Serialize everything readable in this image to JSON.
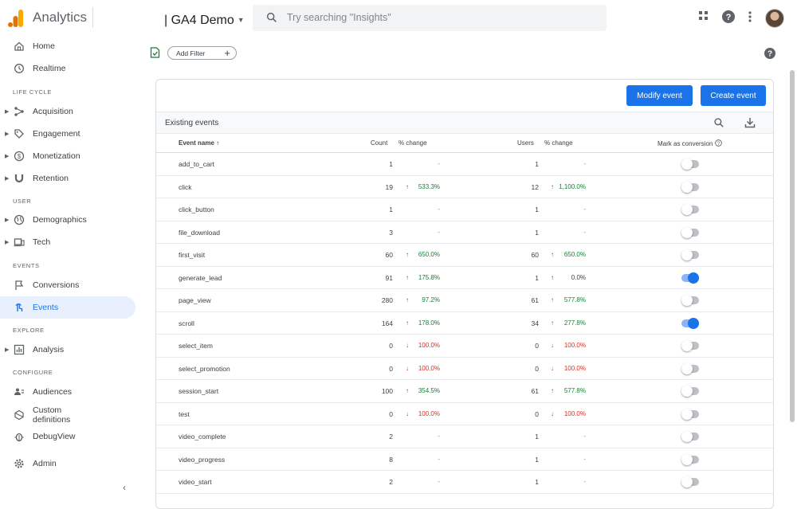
{
  "header": {
    "app_title": "Analytics",
    "property": "| GA4 Demo",
    "search_placeholder": "Try searching \"Insights\""
  },
  "sidebar": {
    "items": [
      {
        "label": "Home"
      },
      {
        "label": "Realtime"
      },
      {
        "label": "Acquisition"
      },
      {
        "label": "Engagement"
      },
      {
        "label": "Monetization"
      },
      {
        "label": "Retention"
      },
      {
        "label": "Demographics"
      },
      {
        "label": "Tech"
      },
      {
        "label": "Conversions"
      },
      {
        "label": "Events"
      },
      {
        "label": "Analysis"
      },
      {
        "label": "Audiences"
      },
      {
        "label": "Custom definitions"
      },
      {
        "label": "DebugView"
      },
      {
        "label": "Admin"
      }
    ],
    "sections": [
      "LIFE CYCLE",
      "USER",
      "EVENTS",
      "EXPLORE",
      "CONFIGURE"
    ]
  },
  "filter": {
    "add_filter_label": "Add Filter",
    "plus": "+"
  },
  "actions": {
    "modify_event": "Modify event",
    "create_event": "Create event"
  },
  "table": {
    "title": "Existing events",
    "columns": {
      "event_name": "Event name",
      "count": "Count",
      "count_change": "% change",
      "users": "Users",
      "users_change": "% change",
      "mark_conversion": "Mark as conversion"
    },
    "rows": [
      {
        "name": "add_to_cart",
        "count": "1",
        "count_change": "-",
        "count_dir": "none",
        "users": "1",
        "users_change": "-",
        "users_dir": "none",
        "conversion": false
      },
      {
        "name": "click",
        "count": "19",
        "count_change": "533.3%",
        "count_dir": "up",
        "users": "12",
        "users_change": "1,100.0%",
        "users_dir": "up",
        "conversion": false
      },
      {
        "name": "click_button",
        "count": "1",
        "count_change": "-",
        "count_dir": "none",
        "users": "1",
        "users_change": "-",
        "users_dir": "none",
        "conversion": false
      },
      {
        "name": "file_download",
        "count": "3",
        "count_change": "-",
        "count_dir": "none",
        "users": "1",
        "users_change": "-",
        "users_dir": "none",
        "conversion": false
      },
      {
        "name": "first_visit",
        "count": "60",
        "count_change": "650.0%",
        "count_dir": "up",
        "users": "60",
        "users_change": "650.0%",
        "users_dir": "up",
        "conversion": false
      },
      {
        "name": "generate_lead",
        "count": "91",
        "count_change": "175.8%",
        "count_dir": "up",
        "users": "1",
        "users_change": "0.0%",
        "users_dir": "neutral",
        "conversion": true
      },
      {
        "name": "page_view",
        "count": "280",
        "count_change": "97.2%",
        "count_dir": "up",
        "users": "61",
        "users_change": "577.8%",
        "users_dir": "up",
        "conversion": false
      },
      {
        "name": "scroll",
        "count": "164",
        "count_change": "178.0%",
        "count_dir": "up",
        "users": "34",
        "users_change": "277.8%",
        "users_dir": "up",
        "conversion": true
      },
      {
        "name": "select_item",
        "count": "0",
        "count_change": "100.0%",
        "count_dir": "down",
        "users": "0",
        "users_change": "100.0%",
        "users_dir": "down",
        "conversion": false
      },
      {
        "name": "select_promotion",
        "count": "0",
        "count_change": "100.0%",
        "count_dir": "down",
        "users": "0",
        "users_change": "100.0%",
        "users_dir": "down",
        "conversion": false
      },
      {
        "name": "session_start",
        "count": "100",
        "count_change": "354.5%",
        "count_dir": "up",
        "users": "61",
        "users_change": "577.8%",
        "users_dir": "up",
        "conversion": false
      },
      {
        "name": "test",
        "count": "0",
        "count_change": "100.0%",
        "count_dir": "down",
        "users": "0",
        "users_change": "100.0%",
        "users_dir": "down",
        "conversion": false
      },
      {
        "name": "video_complete",
        "count": "2",
        "count_change": "-",
        "count_dir": "none",
        "users": "1",
        "users_change": "-",
        "users_dir": "none",
        "conversion": false
      },
      {
        "name": "video_progress",
        "count": "8",
        "count_change": "-",
        "count_dir": "none",
        "users": "1",
        "users_change": "-",
        "users_dir": "none",
        "conversion": false
      },
      {
        "name": "video_start",
        "count": "2",
        "count_change": "-",
        "count_dir": "none",
        "users": "1",
        "users_change": "-",
        "users_dir": "none",
        "conversion": false
      }
    ]
  },
  "colors": {
    "accent": "#1a73e8",
    "up": "#188038",
    "down": "#d93025",
    "active_bg": "#e8f0fe"
  }
}
